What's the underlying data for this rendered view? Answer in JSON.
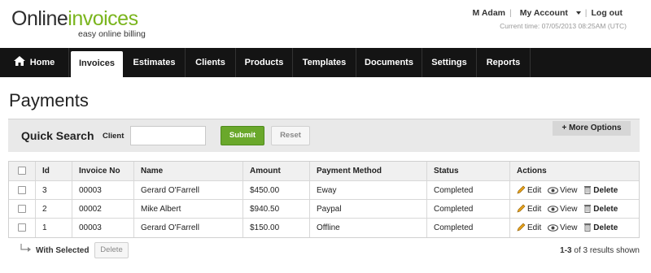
{
  "brand": {
    "logo_part1": "Online",
    "logo_part2": "invoices",
    "tagline": "easy online billing"
  },
  "user_menu": {
    "user": "M Adam",
    "my_account": "My Account",
    "logout": "Log out",
    "current_time": "Current time: 07/05/2013 08:25AM (UTC)"
  },
  "nav": {
    "items": [
      {
        "label": "Home"
      },
      {
        "label": "Invoices"
      },
      {
        "label": "Estimates"
      },
      {
        "label": "Clients"
      },
      {
        "label": "Products"
      },
      {
        "label": "Templates"
      },
      {
        "label": "Documents"
      },
      {
        "label": "Settings"
      },
      {
        "label": "Reports"
      }
    ],
    "active": "Invoices"
  },
  "page": {
    "title": "Payments"
  },
  "search": {
    "label": "Quick Search",
    "client_label": "Client",
    "client_value": "",
    "submit": "Submit",
    "reset": "Reset",
    "more_options": "+ More Options"
  },
  "table": {
    "columns": [
      "Id",
      "Invoice No",
      "Name",
      "Amount",
      "Payment Method",
      "Status",
      "Actions"
    ],
    "rows": [
      {
        "id": "3",
        "invoice": "00003",
        "name": "Gerard O'Farrell",
        "amount": "$450.00",
        "method": "Eway",
        "status": "Completed"
      },
      {
        "id": "2",
        "invoice": "00002",
        "name": "Mike Albert",
        "amount": "$940.50",
        "method": "Paypal",
        "status": "Completed"
      },
      {
        "id": "1",
        "invoice": "00003",
        "name": "Gerard O'Farrell",
        "amount": "$150.00",
        "method": "Offline",
        "status": "Completed"
      }
    ],
    "actions": {
      "edit": "Edit",
      "view": "View",
      "delete": "Delete"
    }
  },
  "footer": {
    "with_selected": "With Selected",
    "delete": "Delete",
    "results_range": "1-3",
    "results_text": "of 3 results shown"
  },
  "colors": {
    "brand_green": "#7ab51d",
    "nav_bg": "#141414",
    "submit_green": "#6aa82b"
  }
}
